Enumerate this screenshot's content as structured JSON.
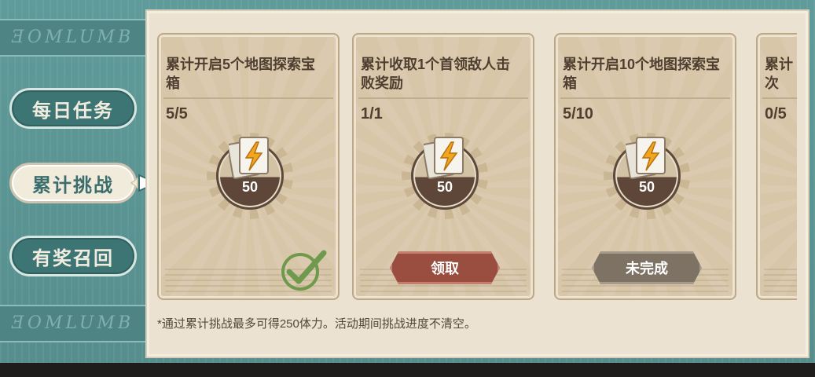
{
  "side_nav": {
    "deco_text": "ƎOMLUMB",
    "items": [
      {
        "label": "每日任务",
        "active": false
      },
      {
        "label": "累计挑战",
        "active": true
      },
      {
        "label": "有奖召回",
        "active": false
      }
    ]
  },
  "cards": [
    {
      "title": "累计开启5个地图探索宝箱",
      "progress": "5/5",
      "reward_icon": "energy-ticket-icon",
      "reward_count": "50",
      "state": "completed"
    },
    {
      "title": "累计收取1个首领敌人击败奖励",
      "progress": "1/1",
      "reward_icon": "energy-ticket-icon",
      "reward_count": "50",
      "state": "claimable",
      "button_label": "领取"
    },
    {
      "title": "累计开启10个地图探索宝箱",
      "progress": "5/10",
      "reward_icon": "energy-ticket-icon",
      "reward_count": "50",
      "state": "incomplete",
      "button_label": "未完成"
    },
    {
      "title": "累计",
      "title_line2": "次",
      "progress": "0/5",
      "state": "partial"
    }
  ],
  "footnote": "*通过累计挑战最多可得250体力。活动期间挑战进度不清空。",
  "colors": {
    "teal": "#5d9796",
    "claim_button": "#9a4e3f",
    "pending_button": "#7d7264",
    "check_green": "#6f9a4d"
  }
}
